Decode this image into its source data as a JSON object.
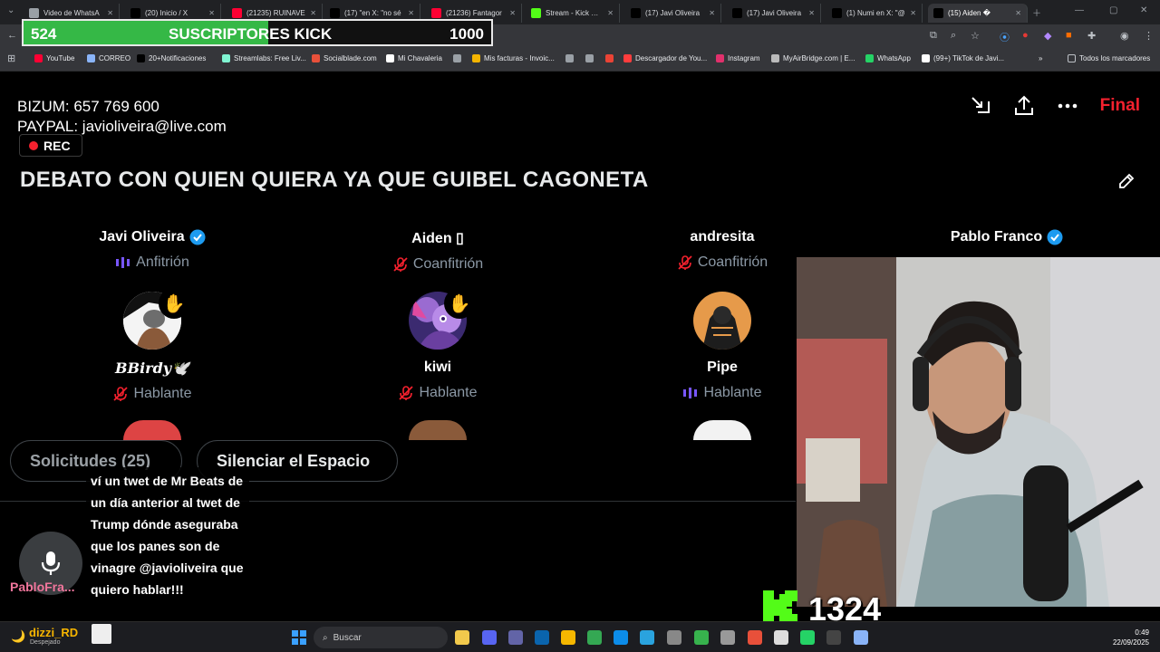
{
  "browser": {
    "tabs": [
      {
        "title": "Video de WhatsA",
        "icon": "globe-icon",
        "color": "#9aa0a6"
      },
      {
        "title": "(20) Inicio / X",
        "icon": "x-icon",
        "color": "#000000"
      },
      {
        "title": "(21235) RUINAVE",
        "icon": "youtube-icon",
        "color": "#ff0033"
      },
      {
        "title": "(17) \"en X: \"no sé",
        "icon": "x-icon",
        "color": "#000000"
      },
      {
        "title": "(21236) Fantagor",
        "icon": "youtube-icon",
        "color": "#ff0033"
      },
      {
        "title": "Stream - Kick Das",
        "icon": "kick-icon",
        "color": "#53fc18"
      },
      {
        "title": "(17) Javi Oliveira",
        "icon": "x-icon",
        "color": "#000000"
      },
      {
        "title": "(17) Javi Oliveira",
        "icon": "x-icon",
        "color": "#000000"
      },
      {
        "title": "(1) Numi en X: \"@",
        "icon": "x-icon",
        "color": "#000000"
      },
      {
        "title": "(15) Aiden �",
        "icon": "x-icon",
        "color": "#000000"
      }
    ],
    "bookmarks": [
      {
        "label": "YouTube",
        "color": "#ff0033"
      },
      {
        "label": "CORREO",
        "color": "#8ab4f8"
      },
      {
        "label": "20+Notificaciones",
        "color": "#000000"
      },
      {
        "label": "Streamlabs: Free Liv...",
        "color": "#80f5d2"
      },
      {
        "label": "Socialblade.com",
        "color": "#e8503a"
      },
      {
        "label": "Mi Chavaleria",
        "color": "#ffffff"
      },
      {
        "label": "",
        "color": "#9aa0a6"
      },
      {
        "label": "Mis facturas - Invoic...",
        "color": "#f4b400"
      },
      {
        "label": "",
        "color": "#9aa0a6"
      },
      {
        "label": "",
        "color": "#9aa0a6"
      },
      {
        "label": "",
        "color": "#ea4335"
      },
      {
        "label": "Descargador de You...",
        "color": "#ff3d3d"
      },
      {
        "label": "Instagram",
        "color": "#e1306c"
      },
      {
        "label": "MyAirBridge.com | E...",
        "color": "#bbbbbb"
      },
      {
        "label": "WhatsApp",
        "color": "#25d366"
      },
      {
        "label": "(99+) TikTok de Javi...",
        "color": "#ffffff"
      }
    ],
    "bookmarks_other": "Todos los marcadores"
  },
  "subs_overlay": {
    "current": "524",
    "label": "SUSCRIPTORES KICK",
    "goal": "1000",
    "progress": 0.524,
    "fill_color": "#35b846"
  },
  "space": {
    "donations_line1": "BIZUM: 657 769 600",
    "donations_line2": "PAYPAL: javioliveira@live.com",
    "rec_label": "REC",
    "final_label": "Final",
    "title": "DEBATO CON QUIEN QUIERA YA QUE GUIBEL CAGONETA",
    "hosts": [
      {
        "name": "Javi Oliveira",
        "verified": true,
        "role": "Anfitrión",
        "role_icon": "speaking-bars-icon"
      },
      {
        "name": "Aiden ▯",
        "verified": false,
        "role": "Coanfitrión",
        "role_icon": "muted-mic-icon"
      },
      {
        "name": "andresita",
        "verified": false,
        "role": "Coanfitrión",
        "role_icon": "muted-mic-icon"
      },
      {
        "name": "Pablo Franco",
        "verified": true,
        "role": "",
        "role_icon": ""
      }
    ],
    "speakers": [
      {
        "name": "𝑩𝑩𝒊𝒓𝒅𝒚🕊️",
        "role": "Hablante",
        "role_icon": "muted-mic-icon",
        "hand": true
      },
      {
        "name": "kiwi",
        "role": "Hablante",
        "role_icon": "muted-mic-icon",
        "hand": true
      },
      {
        "name": "Pipe",
        "role": "Hablante",
        "role_icon": "speaking-bars-icon",
        "hand": false
      }
    ],
    "requests_label": "Solicitudes (25)",
    "mute_label": "Silenciar el Espacio",
    "mic_user": "PabloFra...",
    "donation_message": "ví un twet de Mr Beats de un día anterior al twet de Trump dónde aseguraba que los panes son de vinagre @javioliveira que quiero hablar!!!"
  },
  "kick": {
    "count": "1324",
    "brand_color": "#53fc18"
  },
  "taskbar": {
    "user": "dizzi_RD",
    "weather": "Despejado",
    "search_placeholder": "Buscar",
    "time": "0:49",
    "date": "22/09/2025"
  }
}
